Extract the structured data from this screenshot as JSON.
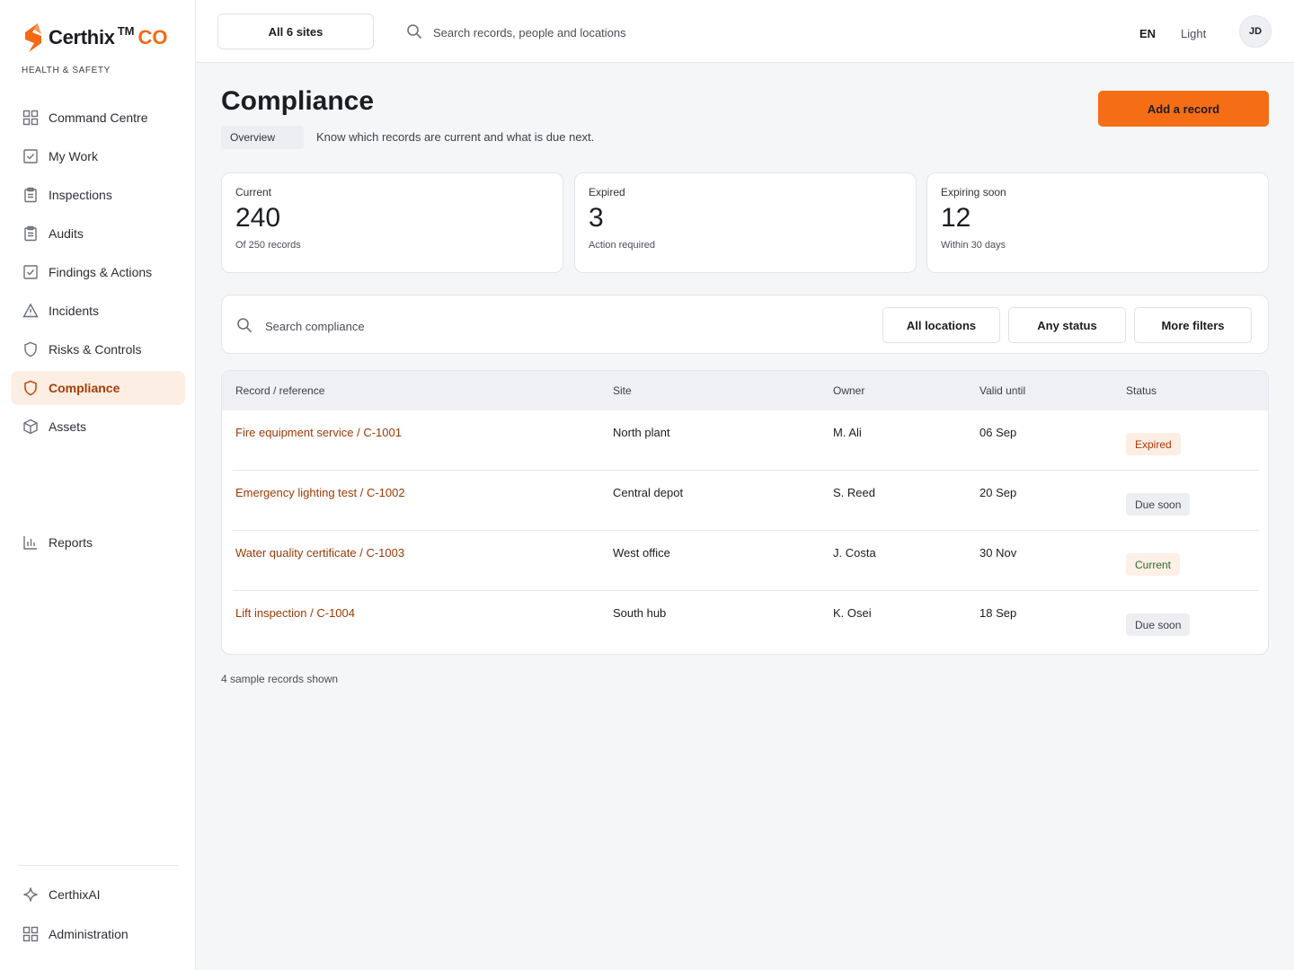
{
  "brand": {
    "name": "Certhix",
    "tm": "TM",
    "suffix": "CO",
    "subtitle": "HEALTH & SAFETY",
    "accent": "#f46a14"
  },
  "sidebar": {
    "items": [
      {
        "label": "Command Centre",
        "icon": "grid-icon"
      },
      {
        "label": "My Work",
        "icon": "checkbox-icon"
      },
      {
        "label": "Inspections",
        "icon": "clipboard-icon"
      },
      {
        "label": "Audits",
        "icon": "clipboard-icon"
      },
      {
        "label": "Findings & Actions",
        "icon": "checkbox-icon"
      },
      {
        "label": "Incidents",
        "icon": "warning-icon"
      },
      {
        "label": "Risks & Controls",
        "icon": "shield-icon"
      },
      {
        "label": "Compliance",
        "icon": "shield-icon",
        "active": true
      },
      {
        "label": "Assets",
        "icon": "cube-icon"
      }
    ],
    "reports": "Reports",
    "bottom": [
      {
        "label": "CerthixAI",
        "icon": "sparkle-icon"
      },
      {
        "label": "Administration",
        "icon": "grid-icon"
      }
    ]
  },
  "topbar": {
    "site_selector": "All 6 sites",
    "search_placeholder": "Search records, people and locations",
    "language": "EN",
    "theme": "Light",
    "avatar_initials": "JD"
  },
  "page": {
    "title": "Compliance",
    "tag": "Overview",
    "subtitle": "Know which records are current and what is due next.",
    "add_button": "Add a record"
  },
  "stats": [
    {
      "label": "Current",
      "value": "240",
      "note": "Of 250 records"
    },
    {
      "label": "Expired",
      "value": "3",
      "note": "Action required"
    },
    {
      "label": "Expiring soon",
      "value": "12",
      "note": "Within 30 days"
    }
  ],
  "filters": {
    "search_placeholder": "Search compliance",
    "locations": "All locations",
    "status": "Any status",
    "more": "More filters"
  },
  "table": {
    "headers": [
      "Record / reference",
      "Site",
      "Owner",
      "Valid until",
      "Status"
    ],
    "rows": [
      {
        "record": "Fire equipment service / C-1001",
        "site": "North plant",
        "owner": "M. Ali",
        "valid": "06 Sep",
        "status": "Expired",
        "kind": "expired"
      },
      {
        "record": "Emergency lighting test / C-1002",
        "site": "Central depot",
        "owner": "S. Reed",
        "valid": "20 Sep",
        "status": "Due soon",
        "kind": "due"
      },
      {
        "record": "Water quality certificate / C-1003",
        "site": "West office",
        "owner": "J. Costa",
        "valid": "30 Nov",
        "status": "Current",
        "kind": "current"
      },
      {
        "record": "Lift inspection / C-1004",
        "site": "South hub",
        "owner": "K. Osei",
        "valid": "18 Sep",
        "status": "Due soon",
        "kind": "due"
      }
    ]
  },
  "footnote": "4 sample records shown"
}
